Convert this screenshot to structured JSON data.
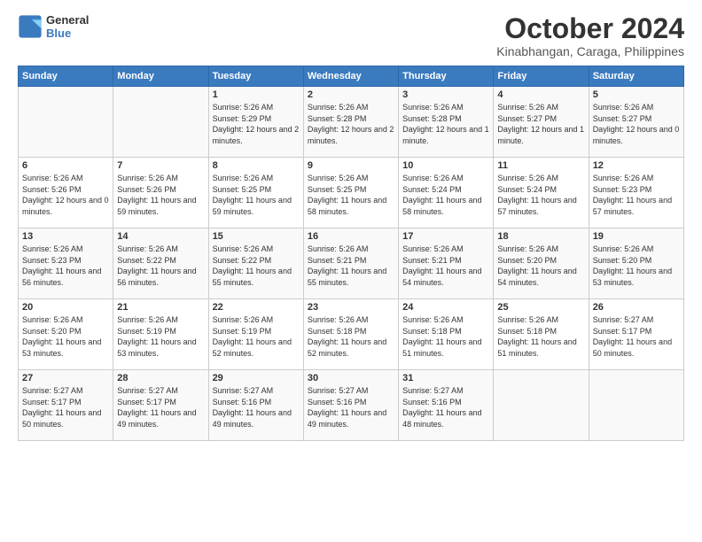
{
  "logo": {
    "line1": "General",
    "line2": "Blue"
  },
  "title": "October 2024",
  "subtitle": "Kinabhangan, Caraga, Philippines",
  "weekdays": [
    "Sunday",
    "Monday",
    "Tuesday",
    "Wednesday",
    "Thursday",
    "Friday",
    "Saturday"
  ],
  "weeks": [
    [
      {
        "day": "",
        "sunrise": "",
        "sunset": "",
        "daylight": ""
      },
      {
        "day": "",
        "sunrise": "",
        "sunset": "",
        "daylight": ""
      },
      {
        "day": "1",
        "sunrise": "Sunrise: 5:26 AM",
        "sunset": "Sunset: 5:29 PM",
        "daylight": "Daylight: 12 hours and 2 minutes."
      },
      {
        "day": "2",
        "sunrise": "Sunrise: 5:26 AM",
        "sunset": "Sunset: 5:28 PM",
        "daylight": "Daylight: 12 hours and 2 minutes."
      },
      {
        "day": "3",
        "sunrise": "Sunrise: 5:26 AM",
        "sunset": "Sunset: 5:28 PM",
        "daylight": "Daylight: 12 hours and 1 minute."
      },
      {
        "day": "4",
        "sunrise": "Sunrise: 5:26 AM",
        "sunset": "Sunset: 5:27 PM",
        "daylight": "Daylight: 12 hours and 1 minute."
      },
      {
        "day": "5",
        "sunrise": "Sunrise: 5:26 AM",
        "sunset": "Sunset: 5:27 PM",
        "daylight": "Daylight: 12 hours and 0 minutes."
      }
    ],
    [
      {
        "day": "6",
        "sunrise": "Sunrise: 5:26 AM",
        "sunset": "Sunset: 5:26 PM",
        "daylight": "Daylight: 12 hours and 0 minutes."
      },
      {
        "day": "7",
        "sunrise": "Sunrise: 5:26 AM",
        "sunset": "Sunset: 5:26 PM",
        "daylight": "Daylight: 11 hours and 59 minutes."
      },
      {
        "day": "8",
        "sunrise": "Sunrise: 5:26 AM",
        "sunset": "Sunset: 5:25 PM",
        "daylight": "Daylight: 11 hours and 59 minutes."
      },
      {
        "day": "9",
        "sunrise": "Sunrise: 5:26 AM",
        "sunset": "Sunset: 5:25 PM",
        "daylight": "Daylight: 11 hours and 58 minutes."
      },
      {
        "day": "10",
        "sunrise": "Sunrise: 5:26 AM",
        "sunset": "Sunset: 5:24 PM",
        "daylight": "Daylight: 11 hours and 58 minutes."
      },
      {
        "day": "11",
        "sunrise": "Sunrise: 5:26 AM",
        "sunset": "Sunset: 5:24 PM",
        "daylight": "Daylight: 11 hours and 57 minutes."
      },
      {
        "day": "12",
        "sunrise": "Sunrise: 5:26 AM",
        "sunset": "Sunset: 5:23 PM",
        "daylight": "Daylight: 11 hours and 57 minutes."
      }
    ],
    [
      {
        "day": "13",
        "sunrise": "Sunrise: 5:26 AM",
        "sunset": "Sunset: 5:23 PM",
        "daylight": "Daylight: 11 hours and 56 minutes."
      },
      {
        "day": "14",
        "sunrise": "Sunrise: 5:26 AM",
        "sunset": "Sunset: 5:22 PM",
        "daylight": "Daylight: 11 hours and 56 minutes."
      },
      {
        "day": "15",
        "sunrise": "Sunrise: 5:26 AM",
        "sunset": "Sunset: 5:22 PM",
        "daylight": "Daylight: 11 hours and 55 minutes."
      },
      {
        "day": "16",
        "sunrise": "Sunrise: 5:26 AM",
        "sunset": "Sunset: 5:21 PM",
        "daylight": "Daylight: 11 hours and 55 minutes."
      },
      {
        "day": "17",
        "sunrise": "Sunrise: 5:26 AM",
        "sunset": "Sunset: 5:21 PM",
        "daylight": "Daylight: 11 hours and 54 minutes."
      },
      {
        "day": "18",
        "sunrise": "Sunrise: 5:26 AM",
        "sunset": "Sunset: 5:20 PM",
        "daylight": "Daylight: 11 hours and 54 minutes."
      },
      {
        "day": "19",
        "sunrise": "Sunrise: 5:26 AM",
        "sunset": "Sunset: 5:20 PM",
        "daylight": "Daylight: 11 hours and 53 minutes."
      }
    ],
    [
      {
        "day": "20",
        "sunrise": "Sunrise: 5:26 AM",
        "sunset": "Sunset: 5:20 PM",
        "daylight": "Daylight: 11 hours and 53 minutes."
      },
      {
        "day": "21",
        "sunrise": "Sunrise: 5:26 AM",
        "sunset": "Sunset: 5:19 PM",
        "daylight": "Daylight: 11 hours and 53 minutes."
      },
      {
        "day": "22",
        "sunrise": "Sunrise: 5:26 AM",
        "sunset": "Sunset: 5:19 PM",
        "daylight": "Daylight: 11 hours and 52 minutes."
      },
      {
        "day": "23",
        "sunrise": "Sunrise: 5:26 AM",
        "sunset": "Sunset: 5:18 PM",
        "daylight": "Daylight: 11 hours and 52 minutes."
      },
      {
        "day": "24",
        "sunrise": "Sunrise: 5:26 AM",
        "sunset": "Sunset: 5:18 PM",
        "daylight": "Daylight: 11 hours and 51 minutes."
      },
      {
        "day": "25",
        "sunrise": "Sunrise: 5:26 AM",
        "sunset": "Sunset: 5:18 PM",
        "daylight": "Daylight: 11 hours and 51 minutes."
      },
      {
        "day": "26",
        "sunrise": "Sunrise: 5:27 AM",
        "sunset": "Sunset: 5:17 PM",
        "daylight": "Daylight: 11 hours and 50 minutes."
      }
    ],
    [
      {
        "day": "27",
        "sunrise": "Sunrise: 5:27 AM",
        "sunset": "Sunset: 5:17 PM",
        "daylight": "Daylight: 11 hours and 50 minutes."
      },
      {
        "day": "28",
        "sunrise": "Sunrise: 5:27 AM",
        "sunset": "Sunset: 5:17 PM",
        "daylight": "Daylight: 11 hours and 49 minutes."
      },
      {
        "day": "29",
        "sunrise": "Sunrise: 5:27 AM",
        "sunset": "Sunset: 5:16 PM",
        "daylight": "Daylight: 11 hours and 49 minutes."
      },
      {
        "day": "30",
        "sunrise": "Sunrise: 5:27 AM",
        "sunset": "Sunset: 5:16 PM",
        "daylight": "Daylight: 11 hours and 49 minutes."
      },
      {
        "day": "31",
        "sunrise": "Sunrise: 5:27 AM",
        "sunset": "Sunset: 5:16 PM",
        "daylight": "Daylight: 11 hours and 48 minutes."
      },
      {
        "day": "",
        "sunrise": "",
        "sunset": "",
        "daylight": ""
      },
      {
        "day": "",
        "sunrise": "",
        "sunset": "",
        "daylight": ""
      }
    ]
  ]
}
